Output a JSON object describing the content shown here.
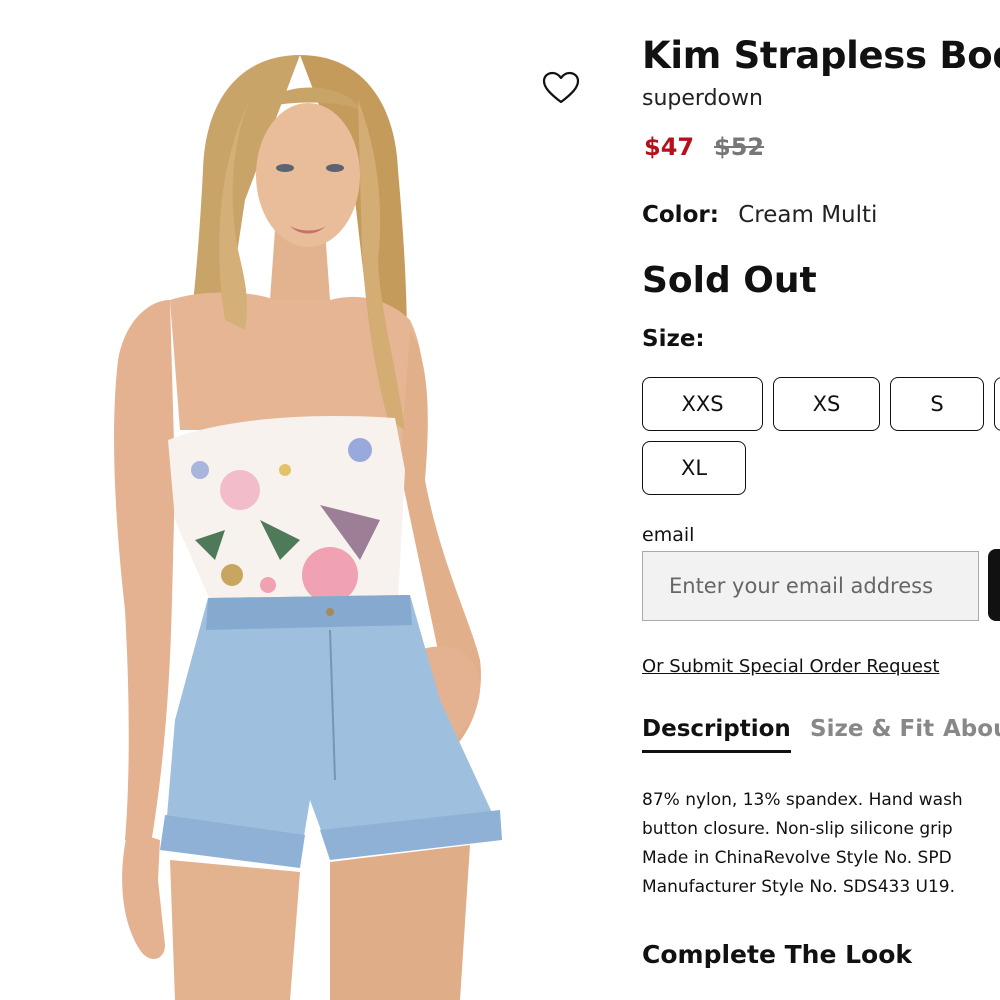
{
  "product": {
    "title": "Kim Strapless Bodysuit",
    "brand": "superdown",
    "price_sale": "$47",
    "price_original": "$52",
    "color_label": "Color:",
    "color_value": "Cream Multi",
    "availability": "Sold Out",
    "size_label": "Size:",
    "sizes": [
      "XXS",
      "XS",
      "S",
      "",
      "XL"
    ]
  },
  "notify": {
    "email_label": "email",
    "email_placeholder": "Enter your email address",
    "special_order_link": "Or Submit Special Order Request"
  },
  "tabs": [
    {
      "label": "Description"
    },
    {
      "label": "Size & Fit"
    },
    {
      "label": "About"
    }
  ],
  "description": {
    "lines": [
      "87% nylon, 13% spandex. Hand wash",
      "button closure. Non-slip silicone grip",
      "Made in ChinaRevolve Style No. SPD",
      "Manufacturer Style No. SDS433 U19."
    ]
  },
  "section": {
    "complete_the_look": "Complete The Look"
  },
  "icons": {
    "wishlist": "heart-icon"
  },
  "colors": {
    "sale_price": "#b3121c",
    "original_price": "#777777",
    "input_bg": "#f2f2f2"
  }
}
